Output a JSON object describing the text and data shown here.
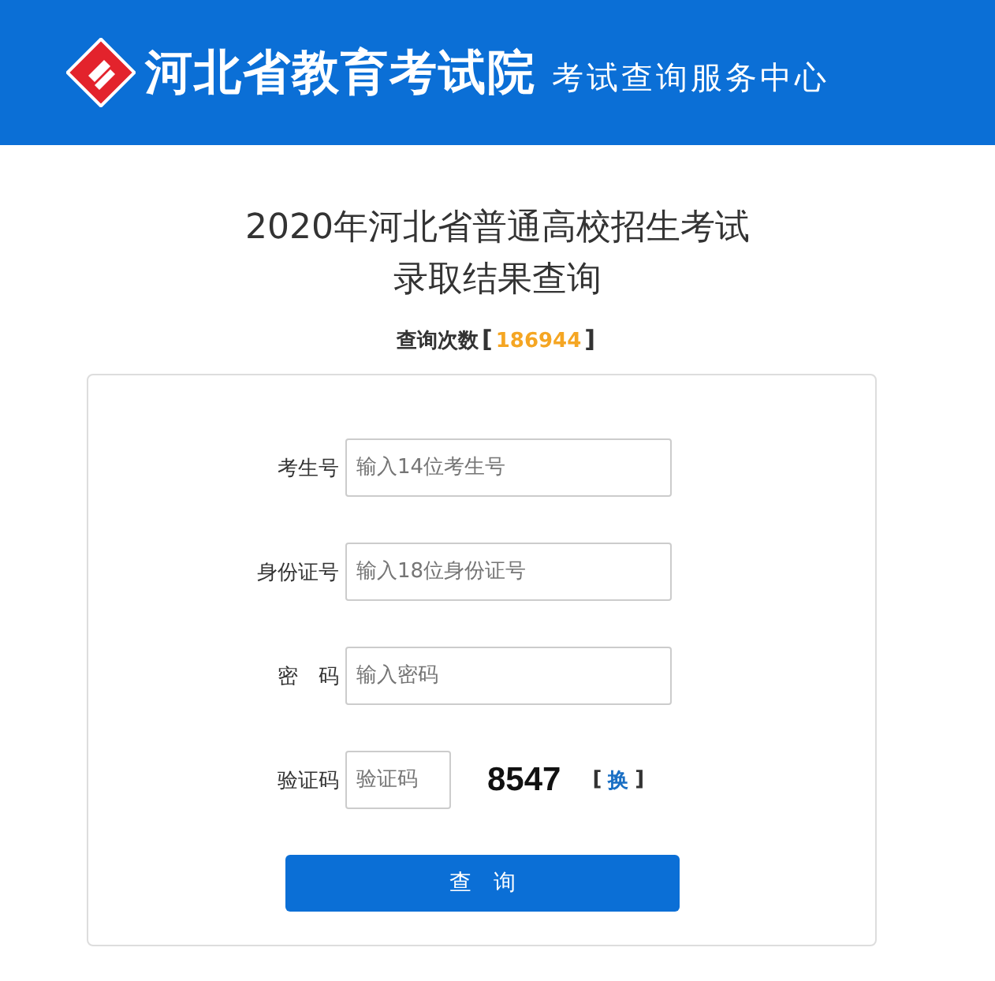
{
  "header": {
    "title": "河北省教育考试院",
    "subtitle": "考试查询服务中心"
  },
  "page_title": [
    "2020年河北省普通高校招生考试",
    "录取结果查询"
  ],
  "counter": {
    "label": "查询次数",
    "open": "[",
    "value": "186944",
    "close": "]"
  },
  "fields": [
    {
      "kind": "text",
      "label": "考生号",
      "placeholder": "输入14位考生号"
    },
    {
      "kind": "text",
      "label": "身份证号",
      "placeholder": "输入18位身份证号"
    },
    {
      "kind": "text",
      "label": "密　码",
      "placeholder": "输入密码"
    },
    {
      "kind": "captcha",
      "label": "验证码",
      "placeholder": "验证码",
      "code": "8547",
      "refresh": {
        "open": "[",
        "label": "换",
        "close": "]"
      }
    }
  ],
  "submit": "查　询"
}
